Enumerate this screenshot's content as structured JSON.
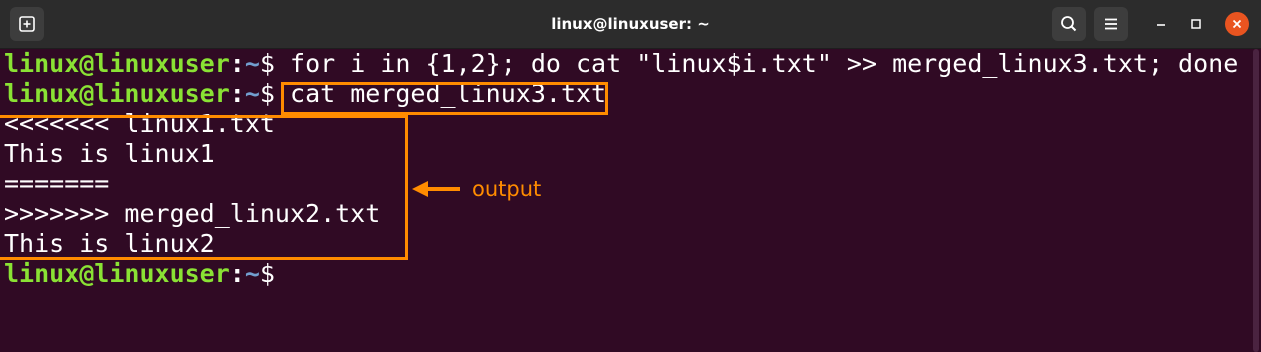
{
  "window": {
    "title": "linux@linuxuser: ~"
  },
  "icons": {
    "new_tab": "new-tab-icon",
    "search": "search-icon",
    "menu": "hamburger-menu-icon",
    "minimize": "minimize-icon",
    "maximize": "maximize-icon",
    "close": "close-icon"
  },
  "prompt": {
    "user": "linux@linuxuser",
    "sep": ":",
    "path": "~",
    "symbol": "$"
  },
  "terminal": {
    "command1": " for i in {1,2}; do cat \"linux$i.txt\" >> merged_linux3.txt; done",
    "command2": " cat merged_linux3.txt",
    "output": [
      "<<<<<<< linux1.txt",
      "This is linux1",
      "=======",
      ">>>>>>> merged_linux2.txt",
      "This is linux2"
    ]
  },
  "annotation": {
    "label": "output",
    "color": "#ff8c00"
  },
  "colors": {
    "background": "#300a24",
    "titlebar": "#2c2c2c",
    "prompt_user": "#8ae234",
    "prompt_path": "#729fcf",
    "close_button": "#e95420"
  }
}
